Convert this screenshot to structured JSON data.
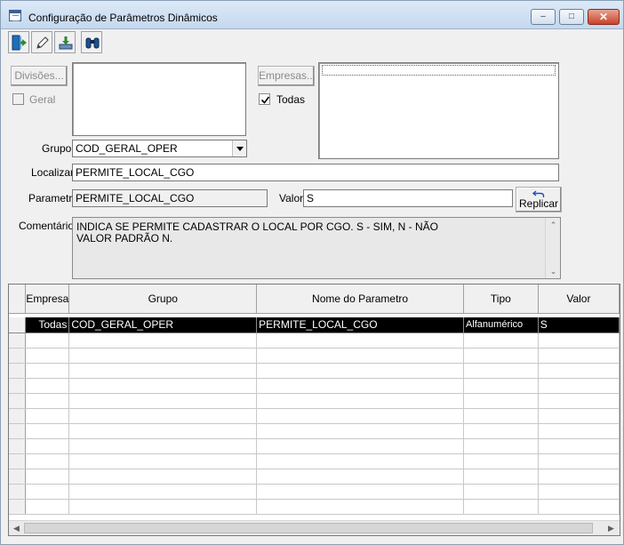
{
  "window": {
    "title": "Configuração de Parâmetros Dinâmicos"
  },
  "toolbar": {
    "icons": [
      "exit-icon",
      "edit-pencil-icon",
      "save-download-icon",
      "find-binoculars-icon"
    ]
  },
  "filters": {
    "divisoes_button": "Divisões...",
    "geral_label": "Geral",
    "empresas_button": "Empresas...",
    "todas_label": "Todas",
    "grupo_label": "Grupo",
    "grupo_value": "COD_GERAL_OPER",
    "localizar_label": "Localizar",
    "localizar_value": "PERMITE_LOCAL_CGO",
    "parametro_label": "Parametro",
    "parametro_value": "PERMITE_LOCAL_CGO",
    "valor_label": "Valor",
    "valor_value": "S",
    "replicar_button": "Replicar",
    "comentarios_label": "Comentários",
    "comentarios_line1": "INDICA SE PERMITE CADASTRAR O LOCAL POR CGO. S  - SIM, N - NÃO",
    "comentarios_line2": "VALOR PADRÃO N."
  },
  "grid": {
    "columns": [
      "Empresa",
      "Grupo",
      "Nome do Parametro",
      "Tipo",
      "Valor"
    ],
    "rows": [
      {
        "empresa": "Todas",
        "grupo": "COD_GERAL_OPER",
        "nome": "PERMITE_LOCAL_CGO",
        "tipo": "Alfanumérico",
        "valor": "S"
      }
    ]
  }
}
